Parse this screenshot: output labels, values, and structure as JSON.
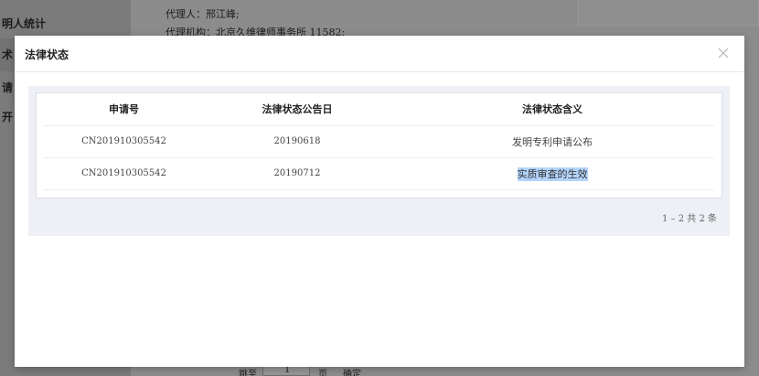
{
  "background": {
    "sidebar_items": [
      "明人统计",
      "术",
      "请",
      "开"
    ],
    "agent_line": "代理人：邢江峰;",
    "agency_line": "代理机构：北京久维律师事务所 11582;",
    "pager": {
      "prefix": "跳至",
      "page_value": "1",
      "suffix": "页",
      "confirm_label": "确定"
    }
  },
  "modal": {
    "title": "法律状态",
    "close_icon": "close-icon",
    "table": {
      "headers": [
        "申请号",
        "法律状态公告日",
        "法律状态含义"
      ],
      "rows": [
        {
          "application_no": "CN201910305542",
          "date": "20190618",
          "meaning": "发明专利申请公布"
        },
        {
          "application_no": "CN201910305542",
          "date": "20190712",
          "meaning": "实质审查的生效"
        }
      ]
    },
    "pagination_summary": "1 – 2 共 2 条"
  }
}
